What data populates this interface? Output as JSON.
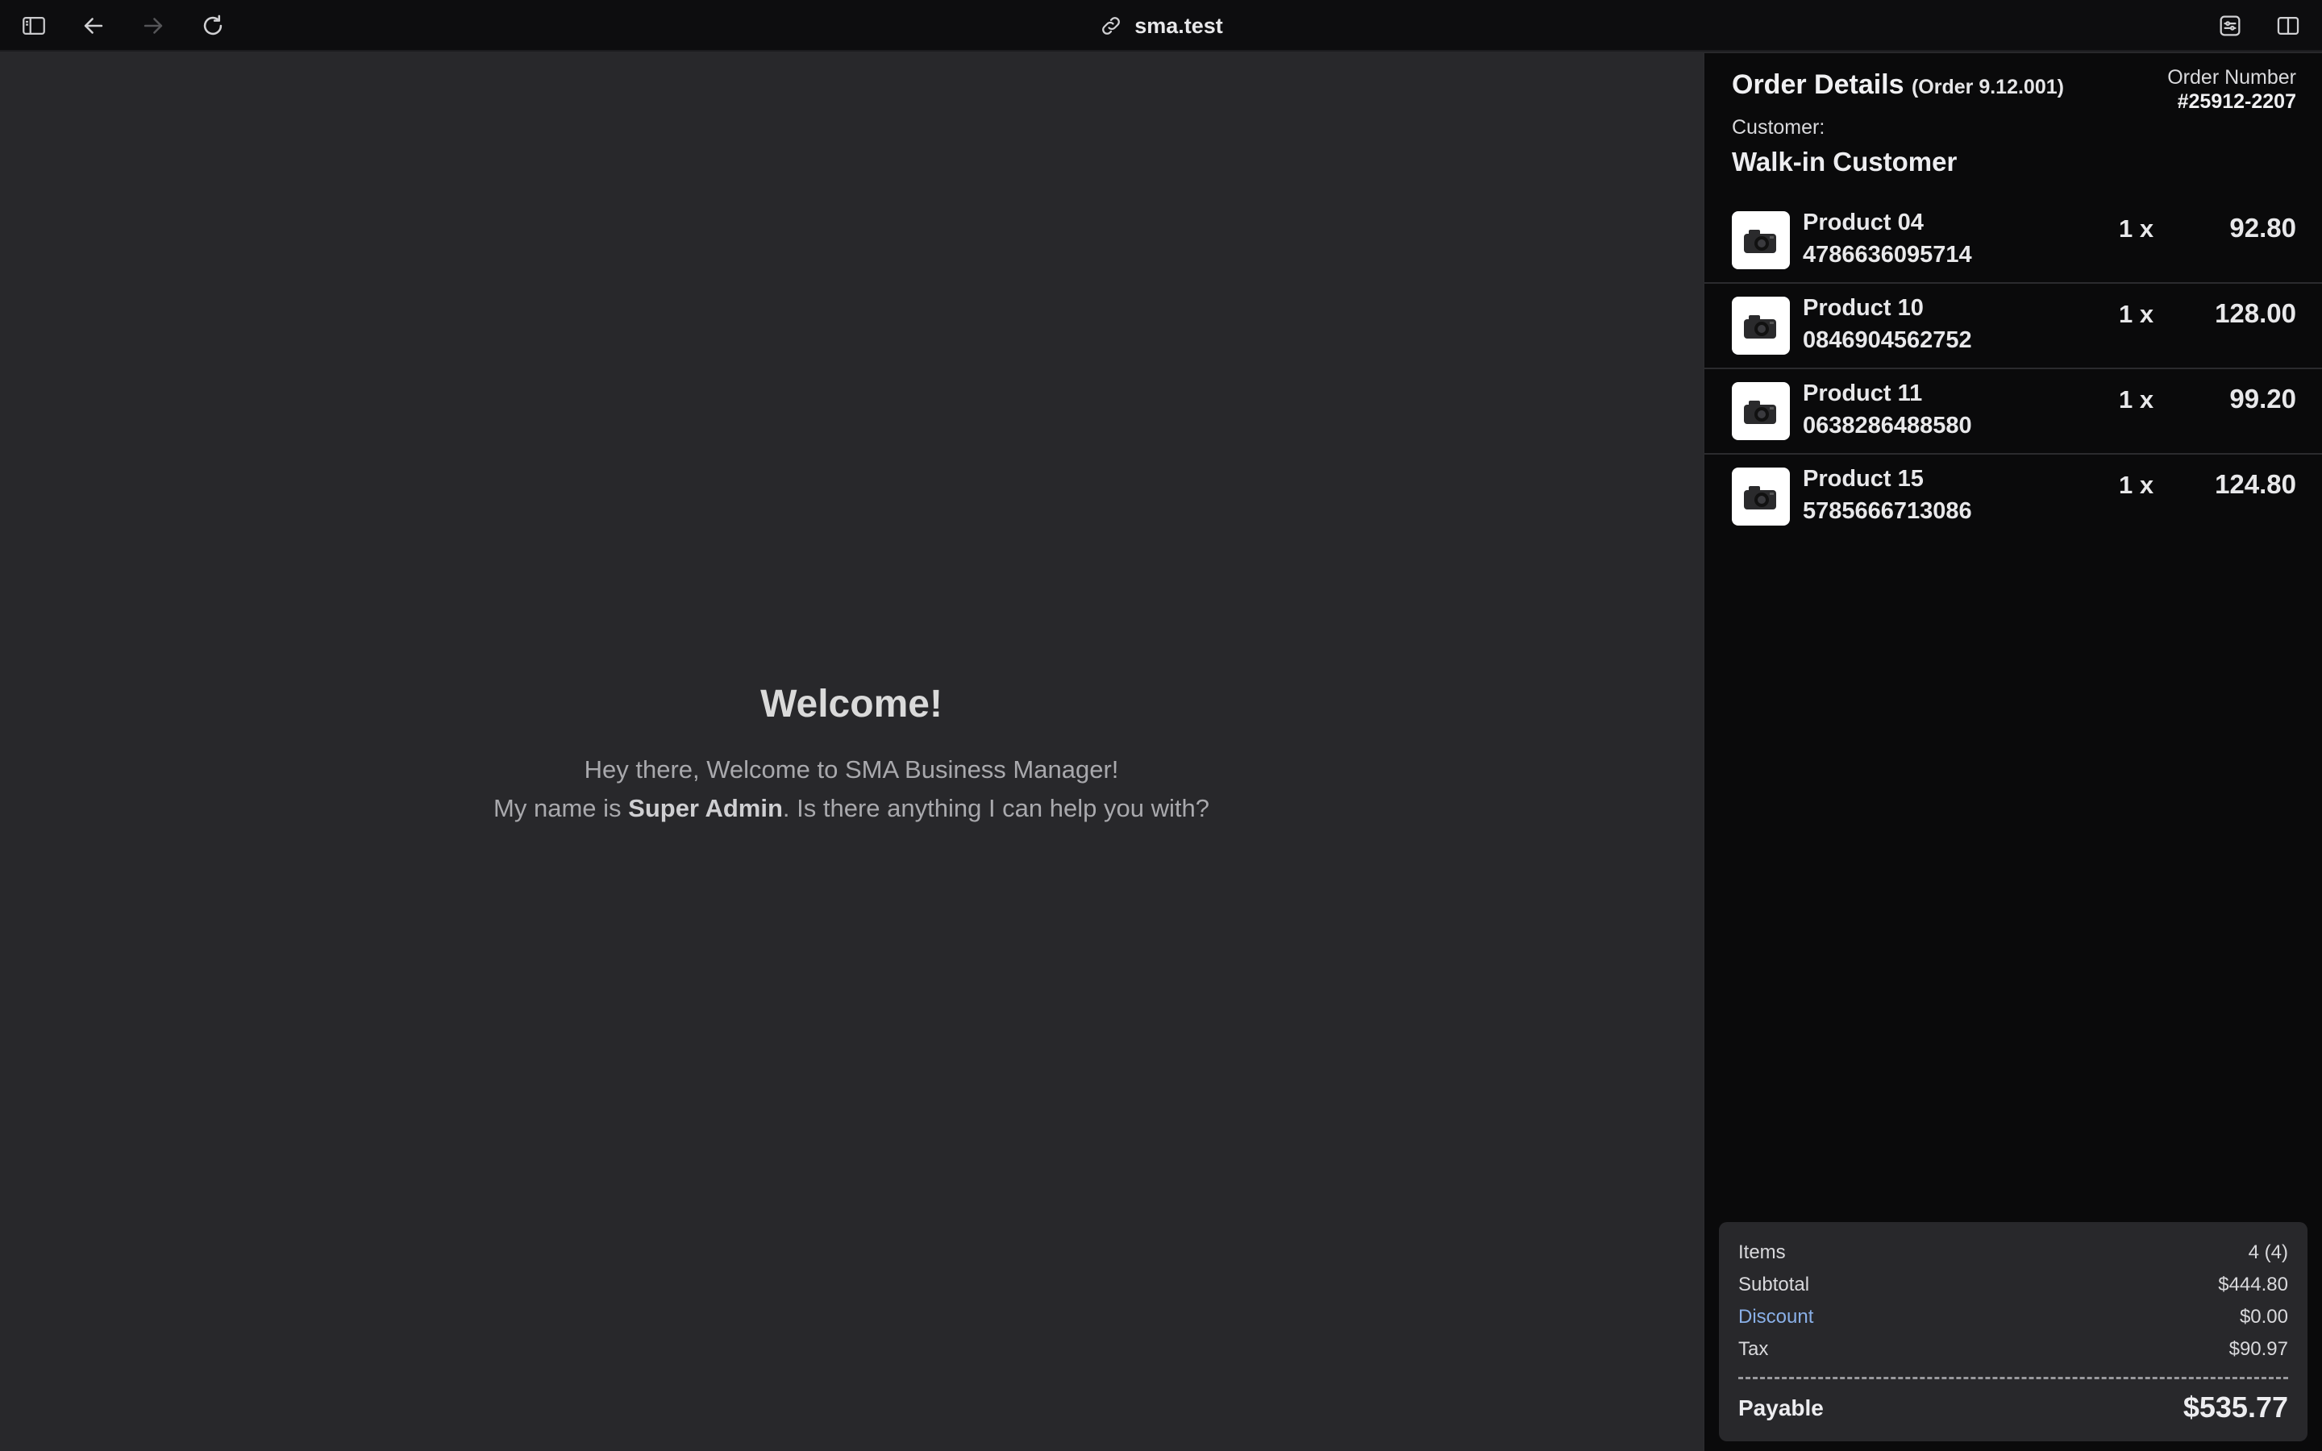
{
  "browser": {
    "url": "sma.test",
    "icons": [
      "sidebar-toggle-icon",
      "back-arrow-icon",
      "forward-arrow-icon",
      "reload-icon",
      "link-icon",
      "page-settings-icon",
      "split-view-icon"
    ]
  },
  "welcome": {
    "title": "Welcome!",
    "line1": "Hey there, Welcome to SMA Business Manager!",
    "line2_prefix": "My name is ",
    "line2_name": "Super Admin",
    "line2_suffix": ". Is there anything I can help you with?"
  },
  "order": {
    "title": "Order Details",
    "subtitle": "(Order 9.12.001)",
    "number_label": "Order Number",
    "number_value": "#25912-2207",
    "customer_label": "Customer:",
    "customer_value": "Walk-in Customer",
    "items": [
      {
        "name": "Product 04",
        "code": "4786636095714",
        "qty": "1 x",
        "price": "92.80",
        "icon": "camera-icon"
      },
      {
        "name": "Product 10",
        "code": "0846904562752",
        "qty": "1 x",
        "price": "128.00",
        "icon": "camera-icon"
      },
      {
        "name": "Product 11",
        "code": "0638286488580",
        "qty": "1 x",
        "price": "99.20",
        "icon": "camera-icon"
      },
      {
        "name": "Product 15",
        "code": "5785666713086",
        "qty": "1 x",
        "price": "124.80",
        "icon": "camera-icon"
      }
    ]
  },
  "totals": {
    "items_label": "Items",
    "items_value": "4 (4)",
    "subtotal_label": "Subtotal",
    "subtotal_value": "$444.80",
    "discount_label": "Discount",
    "discount_value": "$0.00",
    "tax_label": "Tax",
    "tax_value": "$90.97",
    "payable_label": "Payable",
    "payable_value": "$535.77"
  },
  "colors": {
    "link": "#8ab0e8",
    "panel_bg": "#0a0a0b",
    "main_bg": "#28282b"
  }
}
